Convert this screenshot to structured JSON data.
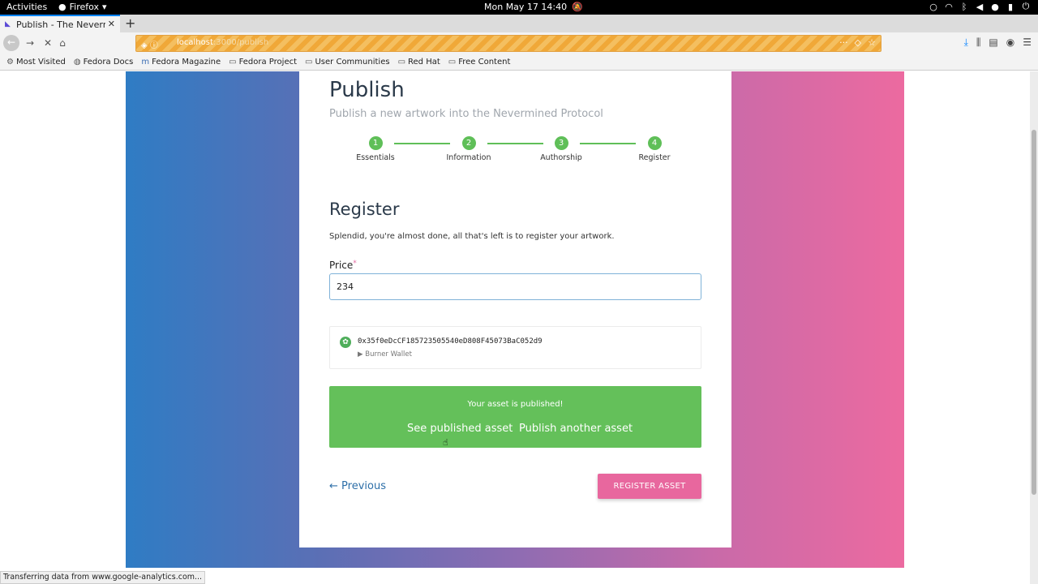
{
  "topbar": {
    "activities": "Activities",
    "app_name": "Firefox",
    "clock": "Mon May 17  14:40",
    "tray_icons": [
      "circle-icon",
      "wifi-icon",
      "bluetooth-icon",
      "volume-icon",
      "mic-icon",
      "battery-icon",
      "power-icon"
    ]
  },
  "browser": {
    "tab_title": "Publish - The Nevermined",
    "url_host": "localhost",
    "url_path": ":3000/publish",
    "bookmarks": [
      "Most Visited",
      "Fedora Docs",
      "Fedora Magazine",
      "Fedora Project",
      "User Communities",
      "Red Hat",
      "Free Content"
    ],
    "status_text": "Transferring data from www.google-analytics.com..."
  },
  "page": {
    "title": "Publish",
    "subtitle": "Publish a new artwork into the Nevermined Protocol",
    "steps": [
      {
        "number": "1",
        "label": "Essentials"
      },
      {
        "number": "2",
        "label": "Information"
      },
      {
        "number": "3",
        "label": "Authorship"
      },
      {
        "number": "4",
        "label": "Register"
      }
    ],
    "section_title": "Register",
    "section_text": "Splendid, you're almost done, all that's left is to register your artwork.",
    "price_label": "Price",
    "price_required_marker": "*",
    "price_value": "234",
    "wallet_address": "0x35f0eDcCF185723505540eD808F45073BaC052d9",
    "wallet_type": "Burner Wallet",
    "success_message": "Your asset is published!",
    "see_published": "See published asset",
    "publish_another": "Publish another asset",
    "previous_label": "← Previous",
    "register_button": "REGISTER ASSET"
  },
  "colors": {
    "accent_green": "#64c05a",
    "accent_pink": "#e8679e",
    "link_blue": "#2d6fa8"
  }
}
